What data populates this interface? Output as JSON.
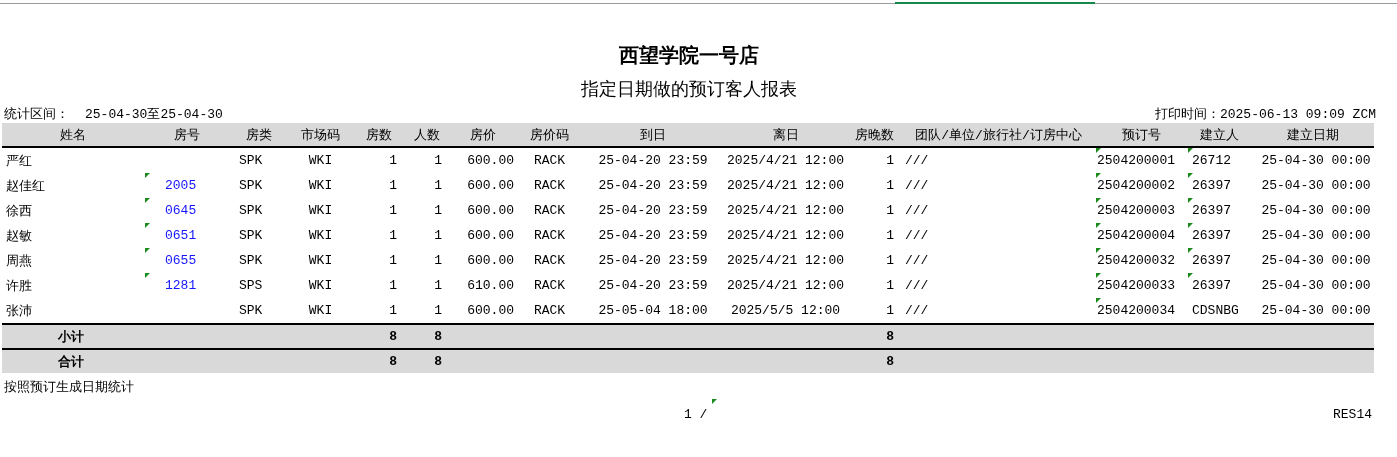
{
  "title": "西望学院一号店",
  "subtitle": "指定日期做的预订客人报表",
  "period": {
    "label": "统计区间：",
    "value": "25-04-30至25-04-30"
  },
  "print_time": "打印时间：2025-06-13 09:09 ZCM",
  "columns": [
    "姓名",
    "房号",
    "房类",
    "市场码",
    "房数",
    "人数",
    "房价",
    "房价码",
    "到日",
    "离日",
    "房晚数",
    "团队/单位/旅行社/订房中心",
    "预订号",
    "建立人",
    "建立日期"
  ],
  "rows": [
    {
      "name": "严红",
      "room_type": "SPK",
      "market": "WKI",
      "rooms": "1",
      "guests": "1",
      "rate": "600.00",
      "rate_code": "RACK",
      "arrival": "25-04-20 23:59",
      "departure": "2025/4/21 12:00",
      "nights": "1",
      "group": "///",
      "booking_no": "2504200001",
      "booking_no_flagged": true,
      "creator": "26712",
      "creator_flagged": true,
      "created": "25-04-30 00:00"
    },
    {
      "name": "赵佳红",
      "room": "2005",
      "room_flagged": true,
      "room_type": "SPK",
      "market": "WKI",
      "rooms": "1",
      "guests": "1",
      "rate": "600.00",
      "rate_code": "RACK",
      "arrival": "25-04-20 23:59",
      "departure": "2025/4/21 12:00",
      "nights": "1",
      "group": "///",
      "booking_no": "2504200002",
      "booking_no_flagged": true,
      "creator": "26397",
      "creator_flagged": true,
      "created": "25-04-30 00:00"
    },
    {
      "name": "徐西",
      "room": "0645",
      "room_flagged": true,
      "room_type": "SPK",
      "market": "WKI",
      "rooms": "1",
      "guests": "1",
      "rate": "600.00",
      "rate_code": "RACK",
      "arrival": "25-04-20 23:59",
      "departure": "2025/4/21 12:00",
      "nights": "1",
      "group": "///",
      "booking_no": "2504200003",
      "booking_no_flagged": true,
      "creator": "26397",
      "creator_flagged": true,
      "created": "25-04-30 00:00"
    },
    {
      "name": "赵敏",
      "room": "0651",
      "room_flagged": true,
      "room_type": "SPK",
      "market": "WKI",
      "rooms": "1",
      "guests": "1",
      "rate": "600.00",
      "rate_code": "RACK",
      "arrival": "25-04-20 23:59",
      "departure": "2025/4/21 12:00",
      "nights": "1",
      "group": "///",
      "booking_no": "2504200004",
      "booking_no_flagged": true,
      "creator": "26397",
      "creator_flagged": true,
      "created": "25-04-30 00:00"
    },
    {
      "name": "周燕",
      "room": "0655",
      "room_flagged": true,
      "room_type": "SPK",
      "market": "WKI",
      "rooms": "1",
      "guests": "1",
      "rate": "600.00",
      "rate_code": "RACK",
      "arrival": "25-04-20 23:59",
      "departure": "2025/4/21 12:00",
      "nights": "1",
      "group": "///",
      "booking_no": "2504200032",
      "booking_no_flagged": true,
      "creator": "26397",
      "creator_flagged": true,
      "created": "25-04-30 00:00"
    },
    {
      "name": "许胜",
      "room": "1281",
      "room_flagged": true,
      "room_type": "SPS",
      "market": "WKI",
      "rooms": "1",
      "guests": "1",
      "rate": "610.00",
      "rate_code": "RACK",
      "arrival": "25-04-20 23:59",
      "departure": "2025/4/21 12:00",
      "nights": "1",
      "group": "///",
      "booking_no": "2504200033",
      "booking_no_flagged": true,
      "creator": "26397",
      "creator_flagged": true,
      "created": "25-04-30 00:00"
    },
    {
      "name": "张沛",
      "room_type": "SPK",
      "market": "WKI",
      "rooms": "1",
      "guests": "1",
      "rate": "600.00",
      "rate_code": "RACK",
      "arrival": "25-05-04 18:00",
      "departure": "2025/5/5 12:00",
      "nights": "1",
      "group": "///",
      "booking_no": "2504200034",
      "booking_no_flagged": true,
      "creator": "CDSNBG",
      "creator_flagged": false,
      "created": "25-04-30 00:00"
    }
  ],
  "totals": [
    {
      "label": "小计",
      "rooms": "8",
      "guests": "8",
      "nights": "8"
    },
    {
      "label": "合计",
      "rooms": "8",
      "guests": "8",
      "nights": "8"
    }
  ],
  "note": "按照预订生成日期统计",
  "footer": {
    "page": "1 /",
    "page_flagged": true,
    "code": "RES14"
  }
}
